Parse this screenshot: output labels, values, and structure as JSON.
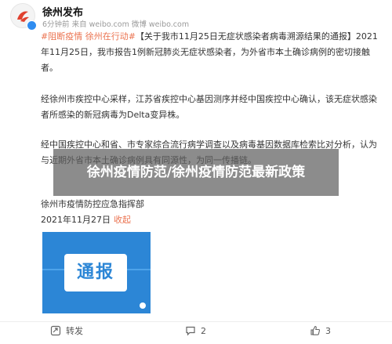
{
  "post": {
    "author": "徐州发布",
    "meta": "6分钟前 来自 weibo.com 微博 weibo.com",
    "tags": "#阻断疫情 徐州在行动#",
    "para1_rest": "【关于我市11月25日无症状感染者病毒溯源结果的通报】2021年11月25日，我市报告1例新冠肺炎无症状感染者，为外省市本土确诊病例的密切接触者。",
    "para2": "经徐州市疾控中心采样，江苏省疾控中心基因测序并经中国疾控中心确认，该无症状感染者所感染的新冠病毒为Delta变异株。",
    "para3": "经中国疾控中心和省、市专家综合流行病学调查以及病毒基因数据库检索比对分析，认为与近期外省市本土确诊病例具有同源性，为同一传播链。",
    "signature": "徐州市疫情防控应急指挥部",
    "date": "2021年11月27日",
    "fold": "收起",
    "image_text": "通报"
  },
  "overlay": {
    "title": "徐州疫情防范/徐州疫情防范最新政策"
  },
  "footer": {
    "repost": "转发",
    "comments": "2",
    "likes": "3"
  },
  "colors": {
    "accent": "#eb7350",
    "image_blue": "#2c86d6",
    "verify_blue": "#2f8cf0"
  }
}
